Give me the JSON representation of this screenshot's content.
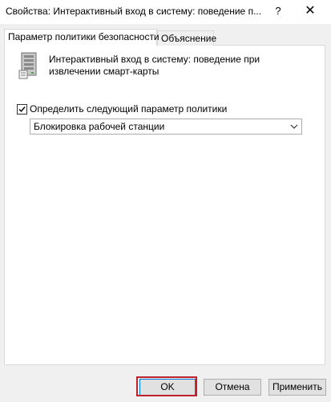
{
  "window": {
    "title": "Свойства: Интерактивный вход в систему:  поведение п...",
    "help_label": "?",
    "close_label": "✕"
  },
  "tabs": [
    {
      "label": "Параметр политики безопасности",
      "active": true
    },
    {
      "label": "Объяснение",
      "active": false
    }
  ],
  "policy": {
    "icon": "server-policy-icon",
    "name": "Интерактивный вход в систему:  поведение при извлечении смарт-карты"
  },
  "define_setting": {
    "label": "Определить следующий параметр политики",
    "checked": true
  },
  "dropdown": {
    "selected": "Блокировка рабочей станции"
  },
  "buttons": {
    "ok": "OK",
    "cancel": "Отмена",
    "apply": "Применить"
  },
  "colors": {
    "highlight": "#c0212f",
    "focus": "#0078d7"
  }
}
